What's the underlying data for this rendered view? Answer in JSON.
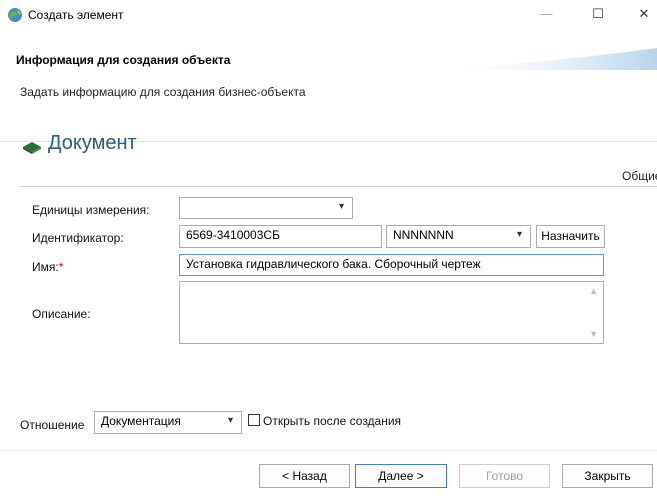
{
  "window": {
    "title": "Создать элемент",
    "minimize_glyph": "—",
    "maximize_glyph": "☐",
    "close_glyph": "✕",
    "icon": "app-globe-icon"
  },
  "banner": {
    "title": "Информация для создания объекта",
    "description": "Задать информацию для создания бизнес-объекта"
  },
  "object": {
    "type_icon": "document-type-icon",
    "type_title": "Документ"
  },
  "tabs": {
    "active_label": "Общие"
  },
  "form": {
    "units_label": "Единицы измерения:",
    "units_value": "",
    "identifier_label": "Идентификатор:",
    "identifier_value": "6569-3410003СБ",
    "identifier_mask_value": "NNNNNNN",
    "assign_button": "Назначить",
    "name_label": "Имя:",
    "name_required_mark": "*",
    "name_value": "Установка гидравлического бака. Сборочный чертеж",
    "description_label": "Описание:",
    "description_value": "",
    "relation_label": "Отношение",
    "relation_value": "Документация",
    "open_after_label": "Открыть после создания",
    "open_after_checked": false
  },
  "footer": {
    "back_button": "< Назад",
    "next_button": "Далее >",
    "finish_button": "Готово",
    "close_button": "Закрыть"
  },
  "colors": {
    "accent_title": "#2a5d8a",
    "required": "#dd0000",
    "primary_border": "#3c7fd6"
  }
}
